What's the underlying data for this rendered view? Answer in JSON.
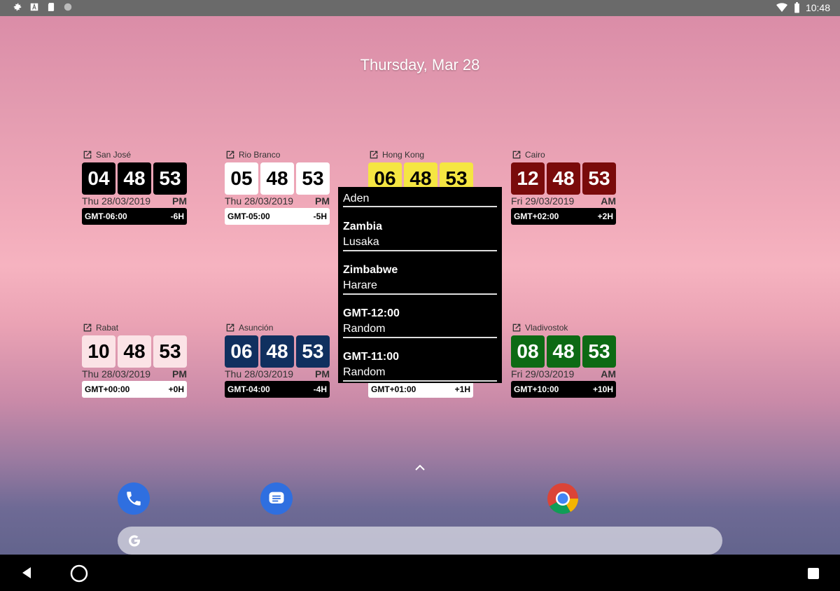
{
  "status_bar": {
    "time": "10:48"
  },
  "home": {
    "date": "Thursday, Mar 28"
  },
  "widgets": [
    {
      "city": "San José",
      "h": "04",
      "m": "48",
      "s": "53",
      "date": "Thu 28/03/2019",
      "ampm": "PM",
      "gmt": "GMT-06:00",
      "offset": "-6H",
      "digit_bg": "#000000",
      "digit_fg": "#ffffff",
      "gmt_bg": "#000000",
      "gmt_fg": "#ffffff"
    },
    {
      "city": "Rio Branco",
      "h": "05",
      "m": "48",
      "s": "53",
      "date": "Thu 28/03/2019",
      "ampm": "PM",
      "gmt": "GMT-05:00",
      "offset": "-5H",
      "digit_bg": "#ffffff",
      "digit_fg": "#000000",
      "gmt_bg": "#ffffff",
      "gmt_fg": "#000000"
    },
    {
      "city": "Hong Kong",
      "h": "06",
      "m": "48",
      "s": "53",
      "date": "",
      "ampm": "",
      "gmt": "",
      "offset": "",
      "digit_bg": "#f5e642",
      "digit_fg": "#000000",
      "gmt_bg": "transparent",
      "gmt_fg": "#000000"
    },
    {
      "city": "Cairo",
      "h": "12",
      "m": "48",
      "s": "53",
      "date": "Fri 29/03/2019",
      "ampm": "AM",
      "gmt": "GMT+02:00",
      "offset": "+2H",
      "digit_bg": "#7a0b0b",
      "digit_fg": "#ffffff",
      "gmt_bg": "#000000",
      "gmt_fg": "#ffffff"
    },
    {
      "city": "Rabat",
      "h": "10",
      "m": "48",
      "s": "53",
      "date": "Thu 28/03/2019",
      "ampm": "PM",
      "gmt": "GMT+00:00",
      "offset": "+0H",
      "digit_bg": "#fbe3e6",
      "digit_fg": "#000000",
      "gmt_bg": "#ffffff",
      "gmt_fg": "#000000"
    },
    {
      "city": "Asunción",
      "h": "06",
      "m": "48",
      "s": "53",
      "date": "Thu 28/03/2019",
      "ampm": "PM",
      "gmt": "GMT-04:00",
      "offset": "-4H",
      "digit_bg": "#10305f",
      "digit_fg": "#ffffff",
      "gmt_bg": "#000000",
      "gmt_fg": "#ffffff"
    },
    {
      "city": "",
      "h": "",
      "m": "",
      "s": "",
      "date": "",
      "ampm": "",
      "gmt": "GMT+01:00",
      "offset": "+1H",
      "digit_bg": "transparent",
      "digit_fg": "#000000",
      "gmt_bg": "#ffffff",
      "gmt_fg": "#000000"
    },
    {
      "city": "Vladivostok",
      "h": "08",
      "m": "48",
      "s": "53",
      "date": "Fri 29/03/2019",
      "ampm": "AM",
      "gmt": "GMT+10:00",
      "offset": "+10H",
      "digit_bg": "#0d6a14",
      "digit_fg": "#ffffff",
      "gmt_bg": "#000000",
      "gmt_fg": "#ffffff"
    }
  ],
  "dropdown": {
    "first_sub": "Aden",
    "items": [
      {
        "title": "Zambia",
        "sub": "Lusaka"
      },
      {
        "title": "Zimbabwe",
        "sub": "Harare"
      },
      {
        "title": "GMT-12:00",
        "sub": "Random"
      },
      {
        "title": "GMT-11:00",
        "sub": "Random"
      }
    ]
  },
  "icons": {
    "status_left": [
      "settings-icon",
      "font-icon",
      "sd-card-icon",
      "circle-icon"
    ],
    "status_right": [
      "wifi-icon",
      "battery-icon"
    ],
    "dock": [
      "phone-icon",
      "messages-icon",
      "chrome-icon"
    ],
    "nav": [
      "back-icon",
      "home-icon",
      "recents-icon"
    ]
  }
}
